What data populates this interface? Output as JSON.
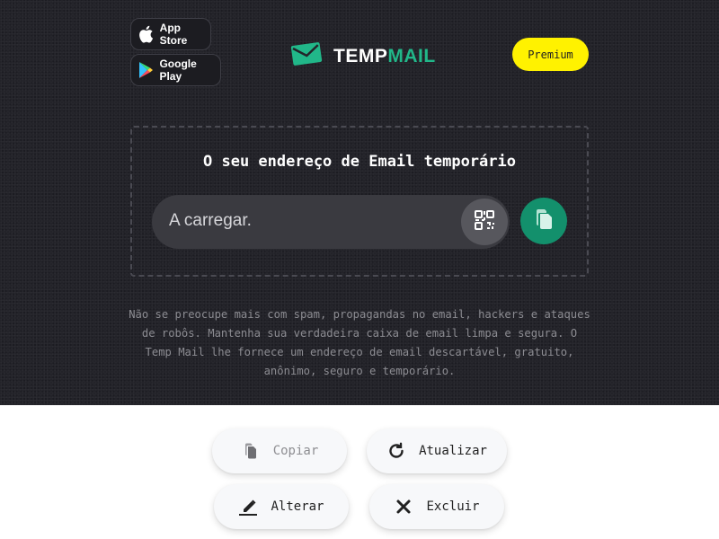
{
  "header": {
    "app_store_label": "App Store",
    "google_play_label": "Google Play",
    "logo_part1": "TEMP",
    "logo_part2": "MAIL",
    "premium_label": "Premium"
  },
  "email": {
    "title": "O seu endereço de Email temporário",
    "value": "A carregar."
  },
  "description": "Não se preocupe mais com spam, propagandas no email, hackers e ataques de robôs. Mantenha sua verdadeira caixa de email limpa e segura. O Temp Mail lhe fornece um endereço de email descartável, gratuito, anônimo, seguro e temporário.",
  "actions": {
    "copy_label": "Copiar",
    "refresh_label": "Atualizar",
    "change_label": "Alterar",
    "delete_label": "Excluir"
  },
  "colors": {
    "background_dark": "#232329",
    "accent_green": "#21b789",
    "copy_button_green": "#13906c",
    "premium_yellow": "#fff200"
  },
  "icons": [
    "apple-icon",
    "google-play-icon",
    "mail-logo-icon",
    "qr-code-icon",
    "copy-icon",
    "refresh-icon",
    "edit-icon",
    "close-icon"
  ]
}
